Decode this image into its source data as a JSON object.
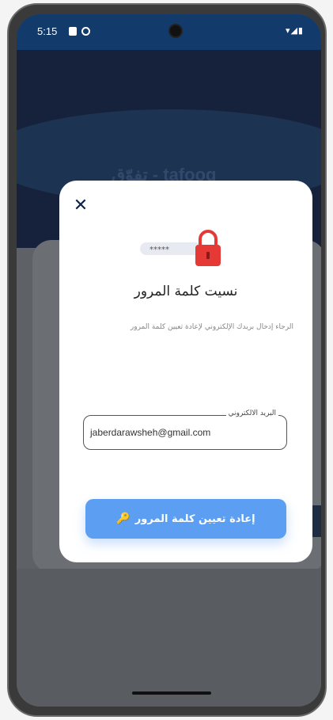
{
  "status_bar": {
    "time": "5:15",
    "signal_icons": "▾◢▮"
  },
  "background": {
    "logo_text": "تفوّق - tafoog"
  },
  "modal": {
    "close_icon": "close-icon",
    "close_glyph": "✕",
    "illustration": {
      "password_dots": "*****",
      "name": "lock-icon"
    },
    "title": "نسيت كلمة المرور",
    "description": "الرجاء إدخال بريدك الإلكتروني لإعادة تعيين كلمة المرور",
    "email": {
      "label": "البريد الالكتروني",
      "value": "jaberdarawsheh@gmail.com"
    },
    "reset_button": {
      "label": "إعادة تعيين كلمة المرور",
      "icon": "key-icon",
      "glyph": "🔑"
    }
  },
  "colors": {
    "status_bar": "#123a6a",
    "primary_button": "#5b9ef2",
    "lock": "#e53935",
    "close": "#0d2144"
  }
}
